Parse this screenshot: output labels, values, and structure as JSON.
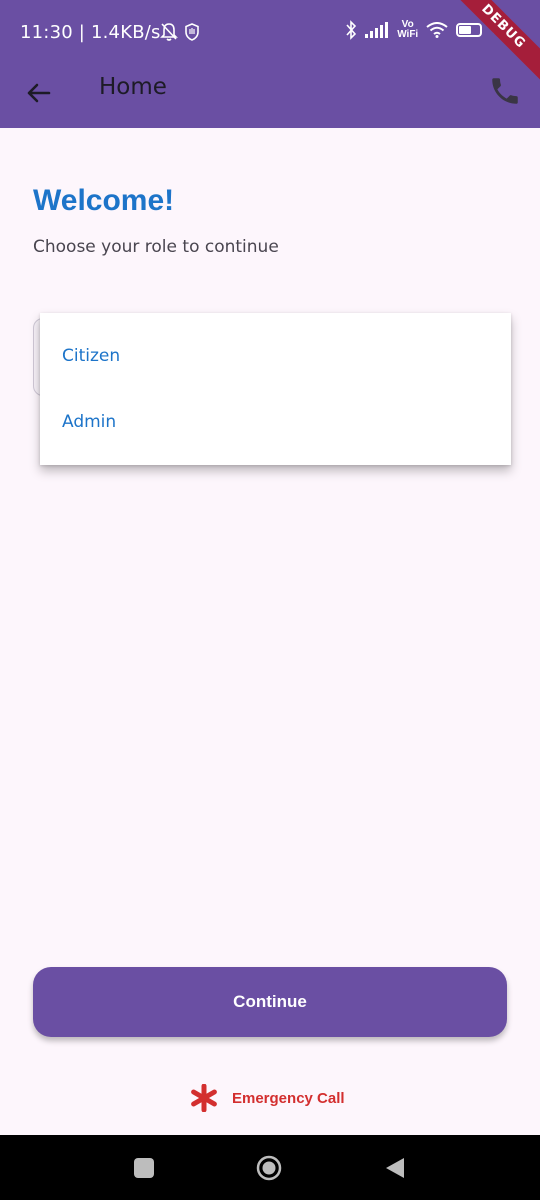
{
  "status_bar": {
    "time": "11:30 | 1.4KB/s",
    "battery": "58",
    "vo_wifi_line1": "Vo",
    "vo_wifi_line2": "WiFi"
  },
  "debug_banner": "DEBUG",
  "app_bar": {
    "title": "Home",
    "back_icon": "arrow-back-icon",
    "action_icon": "phone-icon"
  },
  "main": {
    "heading": "Welcome!",
    "subtitle": "Choose your role to continue"
  },
  "role_menu": {
    "options": [
      "Citizen",
      "Admin"
    ]
  },
  "continue_button": {
    "label": "Continue"
  },
  "emergency": {
    "label": "Emergency Call",
    "icon": "asterisk-icon"
  },
  "colors": {
    "primary": "#6a4fa3",
    "accent_text": "#1d74c9",
    "emergency": "#d32f2f",
    "background": "#fdf6fc"
  },
  "system_nav": {
    "buttons": [
      "recents-icon",
      "home-icon",
      "back-triangle-icon"
    ]
  }
}
